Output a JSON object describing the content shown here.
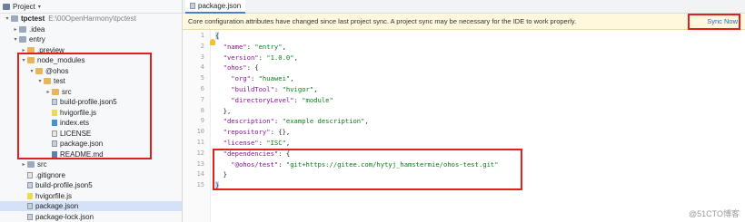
{
  "panel": {
    "title": "Project",
    "tree": [
      {
        "label": "tpctest",
        "extra": "E:\\00OpenHarmony\\tpctest",
        "indent": 0,
        "icon": "folder-b",
        "arrow": "▾",
        "bold": true
      },
      {
        "label": ".idea",
        "indent": 1,
        "icon": "folder-b",
        "arrow": "▸"
      },
      {
        "label": "entry",
        "indent": 1,
        "icon": "folder-b",
        "arrow": "▾"
      },
      {
        "label": ".preview",
        "indent": 2,
        "icon": "folder",
        "arrow": "▸"
      },
      {
        "label": "node_modules",
        "indent": 2,
        "icon": "folder",
        "arrow": "▾"
      },
      {
        "label": "@ohos",
        "indent": 3,
        "icon": "folder",
        "arrow": "▾"
      },
      {
        "label": "test",
        "indent": 4,
        "icon": "folder",
        "arrow": "▾"
      },
      {
        "label": "src",
        "indent": 5,
        "icon": "folder",
        "arrow": "▸"
      },
      {
        "label": "build-profile.json5",
        "indent": 5,
        "icon": "file-json",
        "arrow": ""
      },
      {
        "label": "hvigorfile.js",
        "indent": 5,
        "icon": "file-js",
        "arrow": ""
      },
      {
        "label": "index.ets",
        "indent": 5,
        "icon": "file-ets",
        "arrow": ""
      },
      {
        "label": "LICENSE",
        "indent": 5,
        "icon": "file-txt",
        "arrow": ""
      },
      {
        "label": "package.json",
        "indent": 5,
        "icon": "file-json",
        "arrow": ""
      },
      {
        "label": "README.md",
        "indent": 5,
        "icon": "file-md",
        "arrow": ""
      },
      {
        "label": "src",
        "indent": 2,
        "icon": "folder-b",
        "arrow": "▸"
      },
      {
        "label": ".gitignore",
        "indent": 2,
        "icon": "file-txt",
        "arrow": ""
      },
      {
        "label": "build-profile.json5",
        "indent": 2,
        "icon": "file-json",
        "arrow": ""
      },
      {
        "label": "hvigorfile.js",
        "indent": 2,
        "icon": "file-js",
        "arrow": ""
      },
      {
        "label": "package.json",
        "indent": 2,
        "icon": "file-json",
        "arrow": "",
        "selected": true
      },
      {
        "label": "package-lock.json",
        "indent": 2,
        "icon": "file-json",
        "arrow": ""
      }
    ]
  },
  "tab": {
    "label": "package.json"
  },
  "banner": {
    "text": "Core configuration attributes have changed since last project sync. A project sync may be necessary for the IDE to work properly.",
    "action": "Sync Now"
  },
  "editor": {
    "lines": [
      {
        "n": "1",
        "parts": [
          {
            "t": "{",
            "c": "pun"
          }
        ]
      },
      {
        "n": "2",
        "parts": [
          {
            "t": "  \"name\"",
            "c": "key"
          },
          {
            "t": ": ",
            "c": "pun"
          },
          {
            "t": "\"entry\"",
            "c": "str"
          },
          {
            "t": ",",
            "c": "pun"
          }
        ]
      },
      {
        "n": "3",
        "parts": [
          {
            "t": "  \"version\"",
            "c": "key"
          },
          {
            "t": ": ",
            "c": "pun"
          },
          {
            "t": "\"1.0.0\"",
            "c": "str"
          },
          {
            "t": ",",
            "c": "pun"
          }
        ]
      },
      {
        "n": "4",
        "parts": [
          {
            "t": "  \"ohos\"",
            "c": "key"
          },
          {
            "t": ": {",
            "c": "pun"
          }
        ]
      },
      {
        "n": "5",
        "parts": [
          {
            "t": "    \"org\"",
            "c": "key"
          },
          {
            "t": ": ",
            "c": "pun"
          },
          {
            "t": "\"huawei\"",
            "c": "str"
          },
          {
            "t": ",",
            "c": "pun"
          }
        ]
      },
      {
        "n": "6",
        "parts": [
          {
            "t": "    \"buildTool\"",
            "c": "key"
          },
          {
            "t": ": ",
            "c": "pun"
          },
          {
            "t": "\"hvigor\"",
            "c": "str"
          },
          {
            "t": ",",
            "c": "pun"
          }
        ]
      },
      {
        "n": "7",
        "parts": [
          {
            "t": "    \"directoryLevel\"",
            "c": "key"
          },
          {
            "t": ": ",
            "c": "pun"
          },
          {
            "t": "\"module\"",
            "c": "str"
          }
        ]
      },
      {
        "n": "8",
        "parts": [
          {
            "t": "  },",
            "c": "pun"
          }
        ]
      },
      {
        "n": "9",
        "parts": [
          {
            "t": "  \"description\"",
            "c": "key"
          },
          {
            "t": ": ",
            "c": "pun"
          },
          {
            "t": "\"example description\"",
            "c": "str"
          },
          {
            "t": ",",
            "c": "pun"
          }
        ]
      },
      {
        "n": "10",
        "parts": [
          {
            "t": "  \"repository\"",
            "c": "key"
          },
          {
            "t": ": {},",
            "c": "pun"
          }
        ]
      },
      {
        "n": "11",
        "parts": [
          {
            "t": "  \"license\"",
            "c": "key"
          },
          {
            "t": ": ",
            "c": "pun"
          },
          {
            "t": "\"ISC\"",
            "c": "str"
          },
          {
            "t": ",",
            "c": "pun"
          }
        ]
      },
      {
        "n": "12",
        "parts": [
          {
            "t": "  \"dependencies\"",
            "c": "key"
          },
          {
            "t": ": {",
            "c": "pun"
          }
        ]
      },
      {
        "n": "13",
        "parts": [
          {
            "t": "    \"@ohos/test\"",
            "c": "key"
          },
          {
            "t": ": ",
            "c": "pun"
          },
          {
            "t": "\"git+https://gitee.com/hytyj_hamstermie/ohos-test.git\"",
            "c": "str"
          }
        ]
      },
      {
        "n": "14",
        "parts": [
          {
            "t": "  }",
            "c": "pun"
          }
        ]
      },
      {
        "n": "15",
        "parts": [
          {
            "t": "}",
            "c": "pun"
          }
        ]
      }
    ]
  },
  "watermark": "@51CTO博客"
}
